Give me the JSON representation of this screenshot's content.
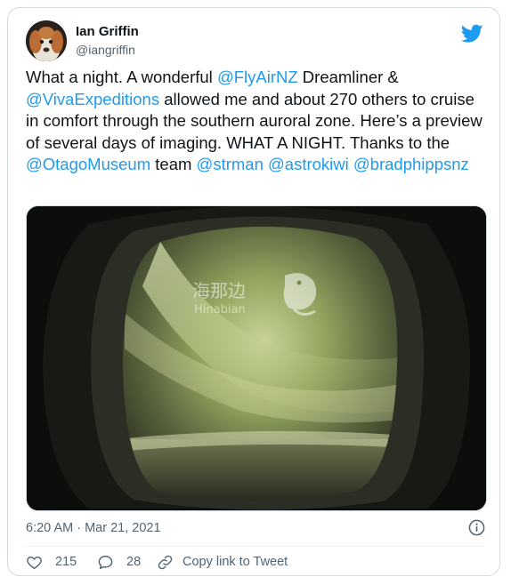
{
  "tweet": {
    "author": {
      "display_name": "Ian Griffin",
      "handle": "@iangriffin"
    },
    "text_segments": [
      {
        "text": "What a night. A wonderful ",
        "type": "text"
      },
      {
        "text": "@FlyAirNZ",
        "type": "mention"
      },
      {
        "text": " Dreamliner & ",
        "type": "text"
      },
      {
        "text": "@VivaExpeditions",
        "type": "mention"
      },
      {
        "text": " allowed me and about 270 others to cruise in comfort through the southern auroral zone. Here’s a preview of several days of imaging. WHAT A NIGHT. Thanks to the ",
        "type": "text"
      },
      {
        "text": "@OtagoMuseum",
        "type": "mention"
      },
      {
        "text": " team ",
        "type": "text"
      },
      {
        "text": "@strman",
        "type": "mention"
      },
      {
        "text": " ",
        "type": "text"
      },
      {
        "text": "@astrokiwi",
        "type": "mention"
      },
      {
        "text": " ",
        "type": "text"
      },
      {
        "text": "@bradphippsnz",
        "type": "mention"
      }
    ],
    "media": {
      "watermark_cn": "海那边",
      "watermark_en": "Hinabian"
    },
    "timestamp": "6:20 AM · Mar 21, 2021",
    "actions": {
      "like_count": "215",
      "reply_count": "28",
      "copy_link_label": "Copy link to Tweet"
    }
  },
  "colors": {
    "accent": "#1d9bf0",
    "like": "#536471",
    "text": "#0f1419",
    "muted": "#536471"
  },
  "icons": [
    "twitter-bird-icon",
    "info-icon",
    "heart-icon",
    "reply-icon",
    "link-icon"
  ]
}
